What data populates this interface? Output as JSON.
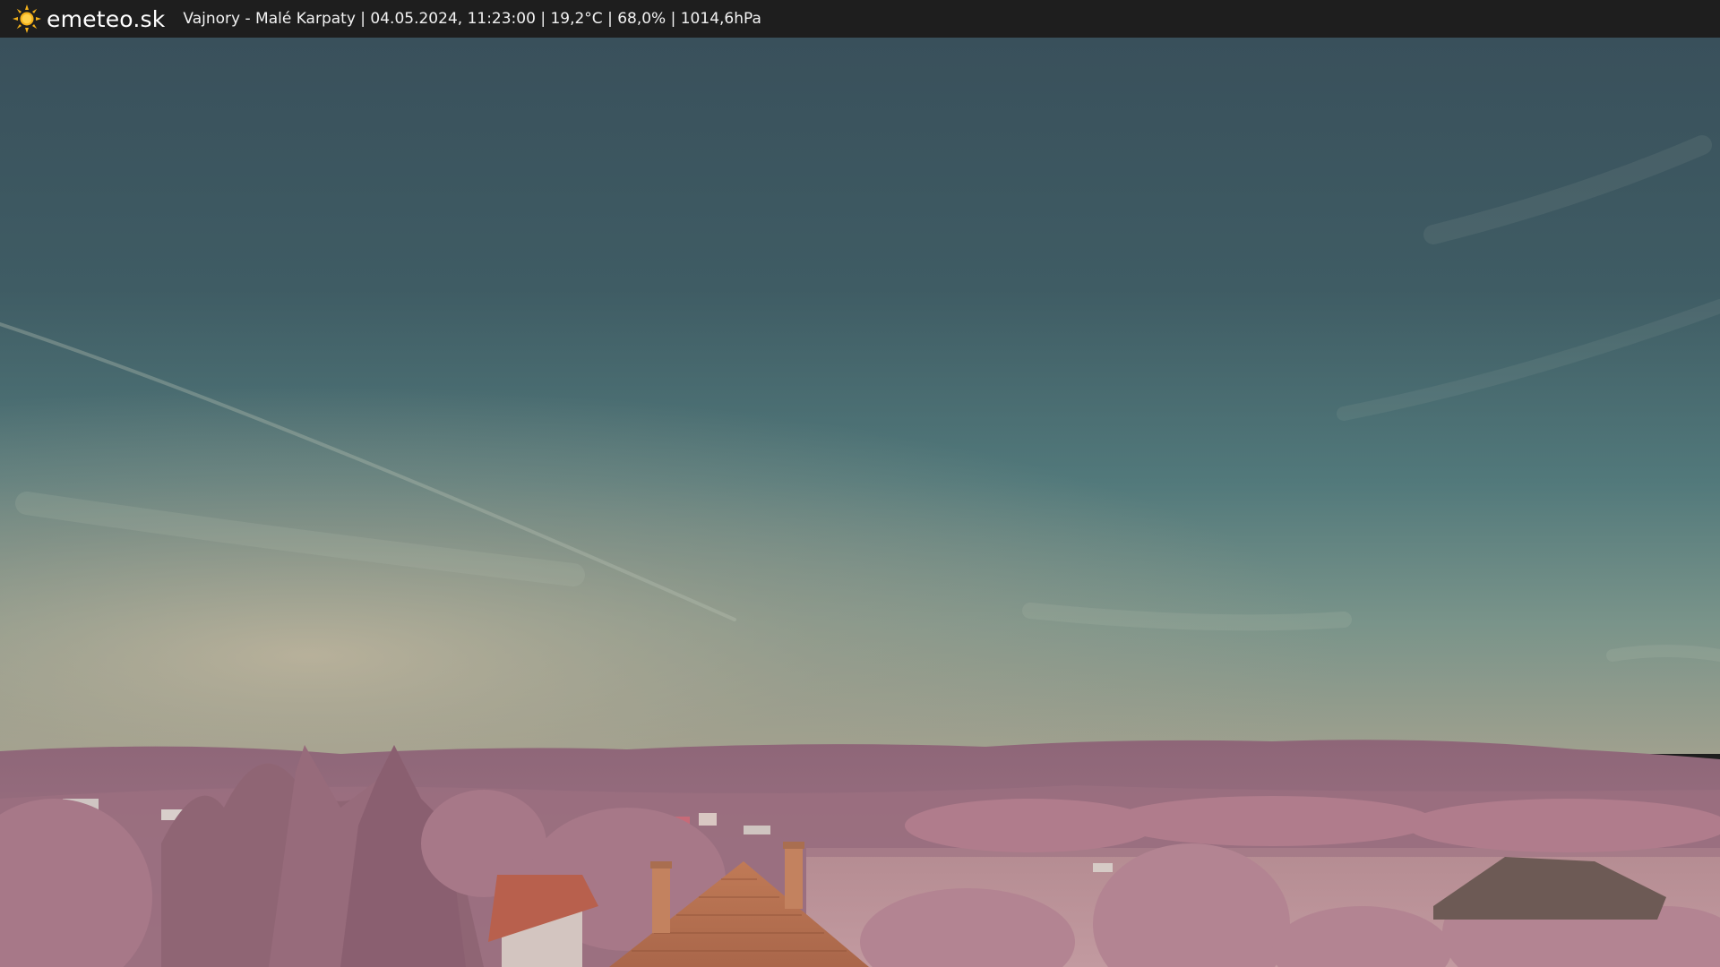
{
  "header": {
    "logo_icon": "sun-icon",
    "logo_text": "emeteo.sk",
    "caption": "Vajnory - Malé Karpaty | 04.05.2024, 11:23:00 | 19,2°C | 68,0% | 1014,6hPa"
  },
  "colors": {
    "bar_background": "#1e1e1e",
    "sun_yellow": "#f5b21b",
    "sky_top": "#39505b",
    "sky_mid": "#4f7376",
    "horizon_haze": "#a9a58f",
    "hills": "#9b6f81",
    "foliage": "#b07c8c",
    "roof": "#b8704f"
  }
}
